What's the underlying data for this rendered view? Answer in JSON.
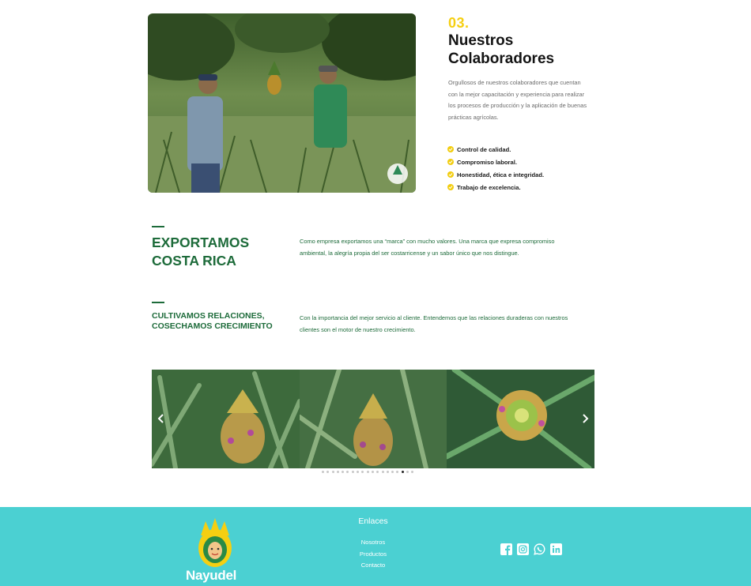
{
  "collaborators": {
    "number": "03.",
    "title": "Nuestros Colaboradores",
    "description": "Orgullosos de nuestros colaboradores que cuentan con la mejor capacitación y experiencia para realizar los procesos de producción y la aplicación de buenas prácticas agrícolas.",
    "features": [
      "Control de calidad.",
      "Compromiso laboral.",
      "Honestidad, ética e integridad.",
      "Trabajo de excelencia."
    ]
  },
  "export": {
    "title": "EXPORTAMOS COSTA RICA",
    "text": "Como empresa exportamos una “marca” con mucho valores. Una marca que expresa compromiso ambiental, la alegría propia del ser costarricense y un sabor único que nos distingue."
  },
  "relations": {
    "title": "CULTIVAMOS RELACIONES, COSECHAMOS CRECIMIENTO",
    "text": "Con la importancia del mejor servicio al cliente. Entendemos que las relaciones duraderas con nuestros clientes son el motor de nuestro crecimiento."
  },
  "carousel": {
    "prev_icon": "chevron-left-icon",
    "next_icon": "chevron-right-icon",
    "dot_count": 19,
    "active_dot": 16
  },
  "footer": {
    "brand": "Nayudel",
    "links_heading": "Enlaces",
    "links": [
      "Nosotros",
      "Productos",
      "Contacto"
    ],
    "socials": [
      "facebook-icon",
      "instagram-icon",
      "whatsapp-icon",
      "linkedin-icon"
    ]
  },
  "colors": {
    "accent_yellow": "#f5cf12",
    "brand_green": "#1d6b3a",
    "footer_teal": "#4bd0d2"
  }
}
